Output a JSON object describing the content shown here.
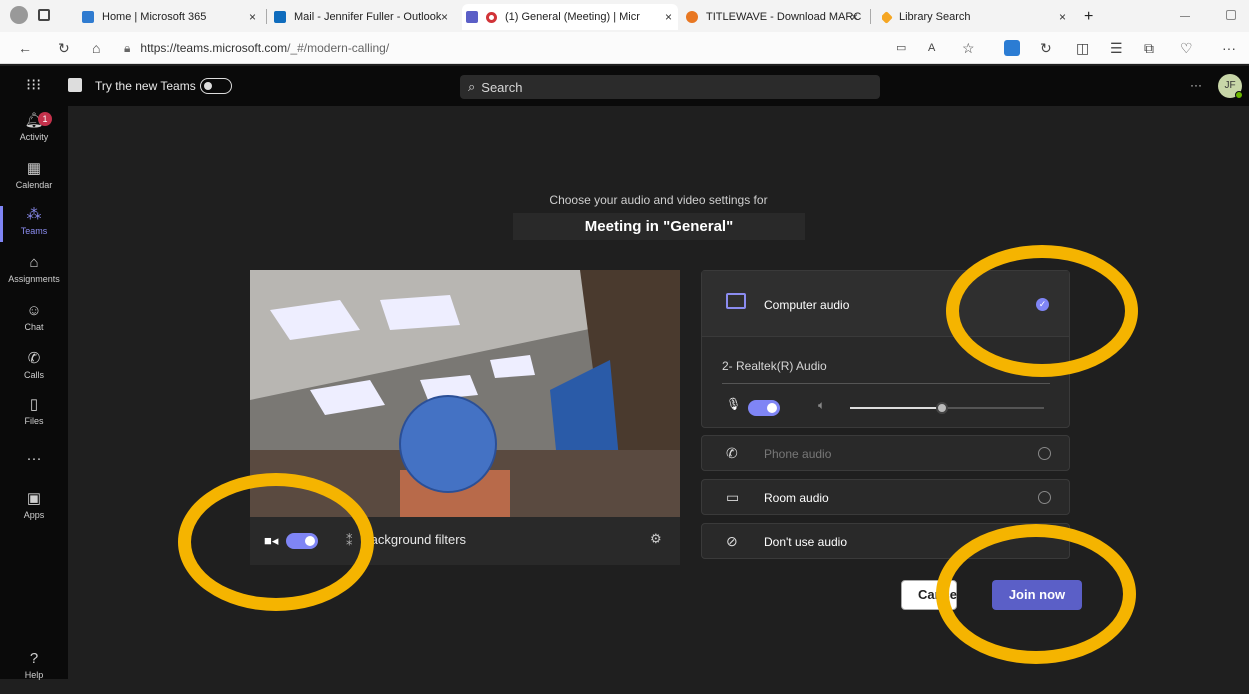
{
  "browser": {
    "tabs": [
      {
        "label": "Home | Microsoft 365",
        "color": "#2f7bd0"
      },
      {
        "label": "Mail - Jennifer Fuller - Outlook",
        "color": "#0f6cbd"
      },
      {
        "label": "(1) General (Meeting) | Micr",
        "color": "#5b5fc7"
      },
      {
        "label": "TITLEWAVE - Download MARC Re",
        "color": "#e87722"
      },
      {
        "label": "Library Search",
        "color": "#f5a623"
      }
    ],
    "url_host": "https://teams.microsoft.com",
    "url_path": "/_#/modern-calling/",
    "close_glyph": "×",
    "new_tab_glyph": "+"
  },
  "teams": {
    "try_new": "Try the new Teams",
    "search_placeholder": "Search",
    "more_glyph": "···",
    "avatar_initials": "JF",
    "rail": [
      {
        "label": "Activity",
        "icon": "bell-icon",
        "badge": "1"
      },
      {
        "label": "Calendar",
        "icon": "calendar-icon"
      },
      {
        "label": "Teams",
        "icon": "teams-icon"
      },
      {
        "label": "Assignments",
        "icon": "assignments-icon"
      },
      {
        "label": "Chat",
        "icon": "chat-icon"
      },
      {
        "label": "Calls",
        "icon": "phone-icon"
      },
      {
        "label": "Files",
        "icon": "file-icon"
      },
      {
        "label": "Apps",
        "icon": "apps-icon"
      },
      {
        "label": "Help",
        "icon": "help-icon"
      }
    ],
    "rail_more": "···"
  },
  "prejoin": {
    "choose_text": "Choose your audio and video settings for",
    "meeting_title": "Meeting in \"General\"",
    "background_filters": "Background filters",
    "computer_audio": "Computer audio",
    "device": "2- Realtek(R) Audio",
    "options": [
      {
        "label": "Phone audio",
        "icon": "phone-audio-icon"
      },
      {
        "label": "Room audio",
        "icon": "room-audio-icon"
      },
      {
        "label": "Don't use audio",
        "icon": "no-audio-icon"
      }
    ],
    "cancel": "Cancel",
    "join": "Join now"
  },
  "colors": {
    "accent": "#7f85f5",
    "join": "#5b5fc7",
    "highlight": "#f5b400"
  }
}
